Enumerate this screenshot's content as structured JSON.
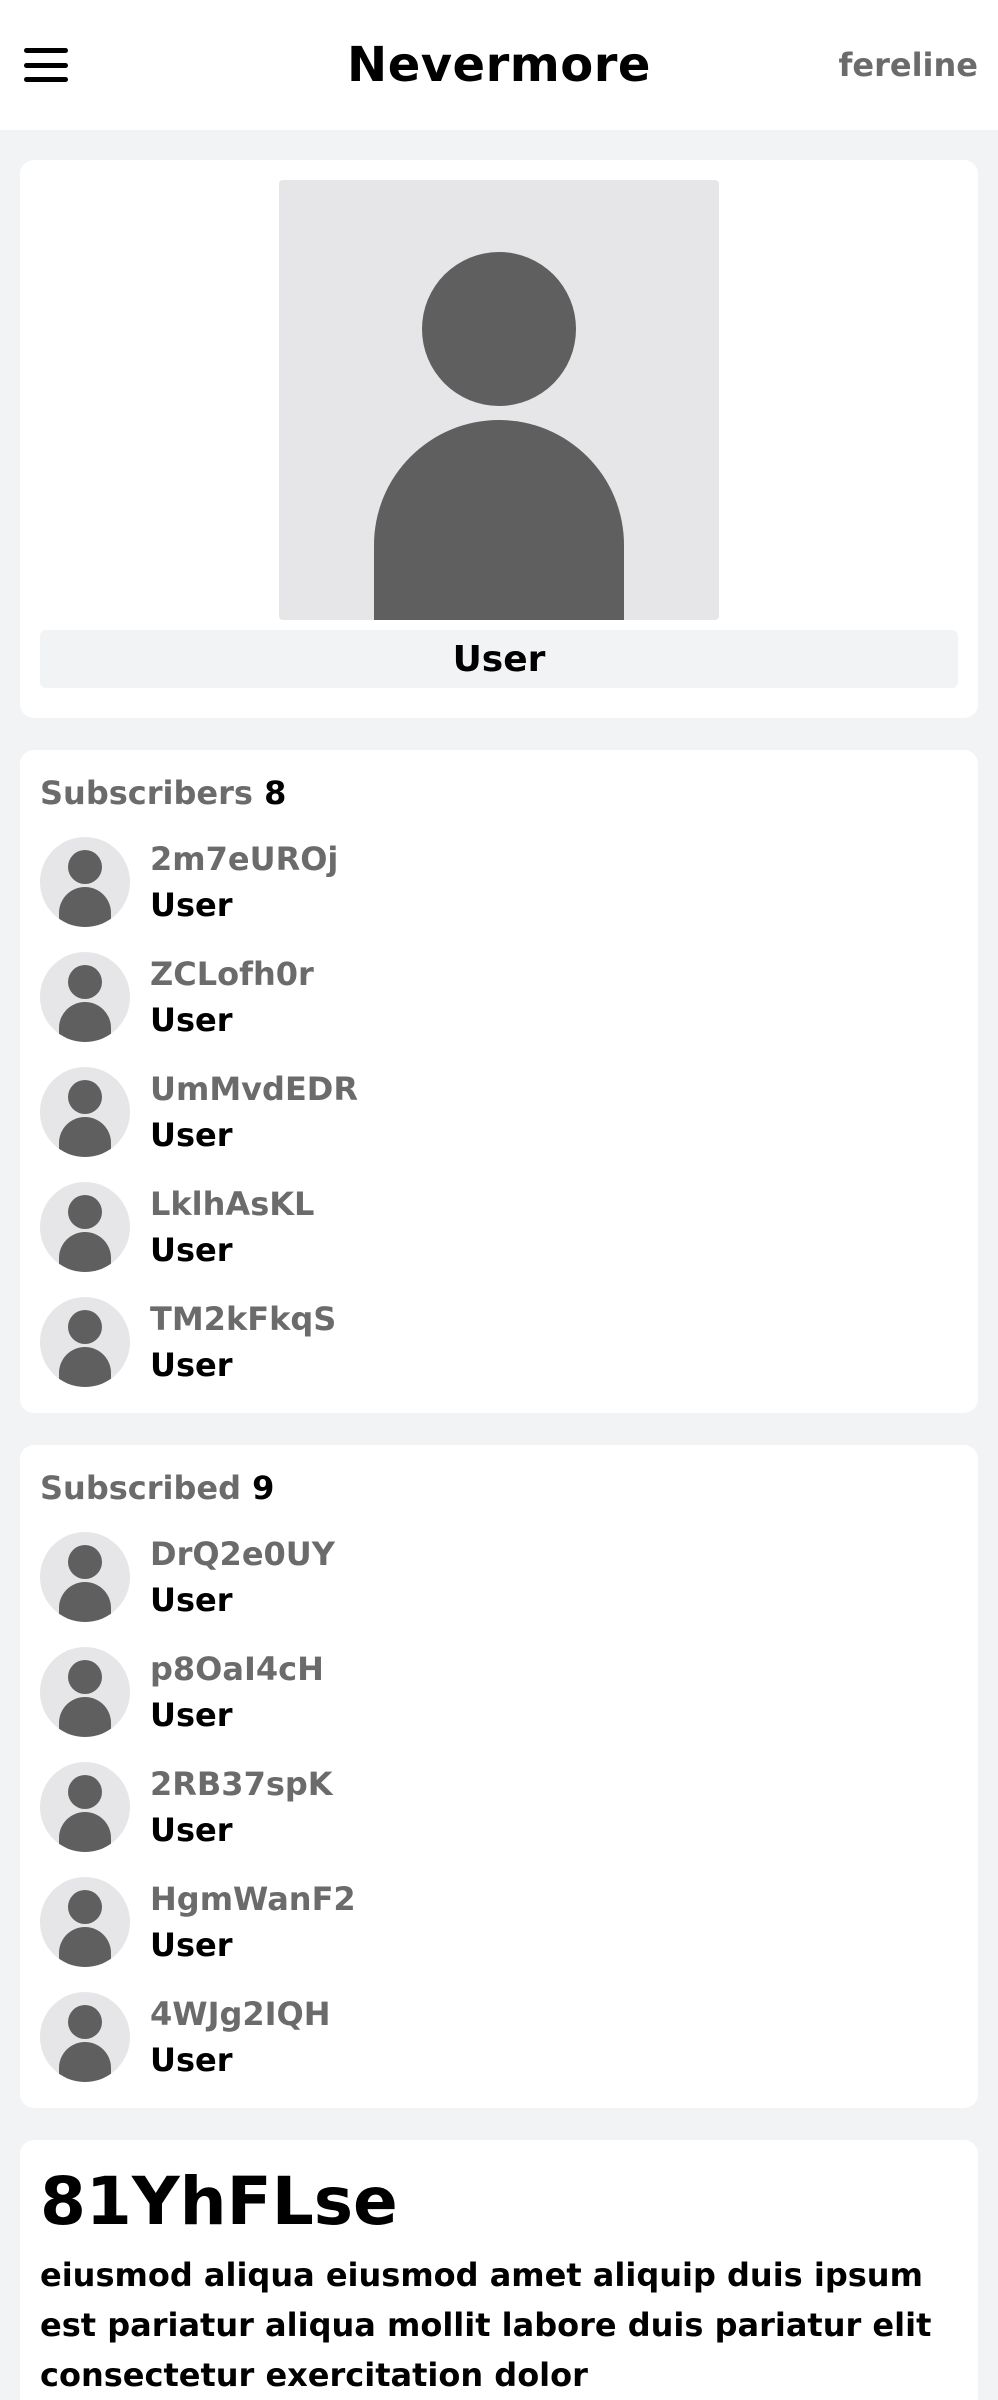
{
  "header": {
    "app_title": "Nevermore",
    "username": "fereline"
  },
  "profile": {
    "role": "User"
  },
  "subscribers": {
    "label": "Subscribers",
    "count": "8",
    "items": [
      {
        "name": "2m7eUROj",
        "role": "User"
      },
      {
        "name": "ZCLofh0r",
        "role": "User"
      },
      {
        "name": "UmMvdEDR",
        "role": "User"
      },
      {
        "name": "LklhAsKL",
        "role": "User"
      },
      {
        "name": "TM2kFkqS",
        "role": "User"
      }
    ]
  },
  "subscribed": {
    "label": "Subscribed",
    "count": "9",
    "items": [
      {
        "name": "DrQ2e0UY",
        "role": "User"
      },
      {
        "name": "p8OaI4cH",
        "role": "User"
      },
      {
        "name": "2RB37spK",
        "role": "User"
      },
      {
        "name": "HgmWanF2",
        "role": "User"
      },
      {
        "name": "4WJg2IQH",
        "role": "User"
      }
    ]
  },
  "post": {
    "title": "81YhFLse",
    "body": "eiusmod aliqua eiusmod amet aliquip duis ipsum est pariatur aliqua mollit labore duis pariatur elit consectetur exercitation dolor"
  }
}
